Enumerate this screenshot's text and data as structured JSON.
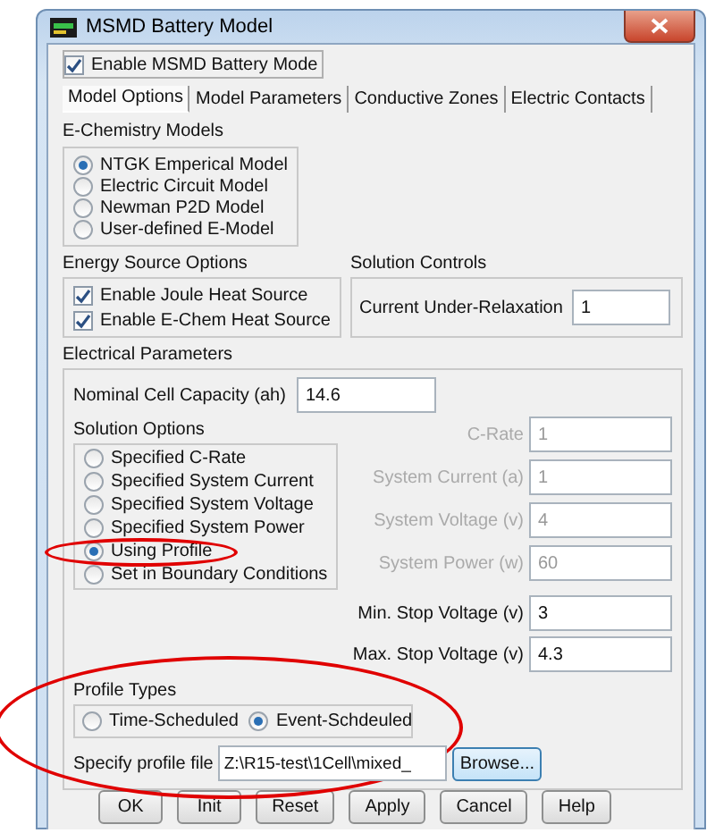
{
  "window": {
    "title": "MSMD Battery Model"
  },
  "enable_model": {
    "label": "Enable MSMD Battery Mode",
    "checked": true
  },
  "tabs": [
    {
      "label": "Model Options",
      "selected": true
    },
    {
      "label": "Model Parameters",
      "selected": false
    },
    {
      "label": "Conductive Zones",
      "selected": false
    },
    {
      "label": "Electric Contacts",
      "selected": false
    }
  ],
  "e_chemistry": {
    "title": "E-Chemistry Models",
    "options": [
      {
        "label": "NTGK Emperical Model",
        "selected": true
      },
      {
        "label": "Electric Circuit Model",
        "selected": false
      },
      {
        "label": "Newman P2D Model",
        "selected": false
      },
      {
        "label": "User-defined E-Model",
        "selected": false
      }
    ]
  },
  "energy_source": {
    "title": "Energy Source Options",
    "options": [
      {
        "label": "Enable Joule Heat Source",
        "checked": true
      },
      {
        "label": "Enable E-Chem Heat Source",
        "checked": true
      }
    ]
  },
  "solution_controls": {
    "title": "Solution Controls",
    "label": "Current Under-Relaxation",
    "value": "1"
  },
  "electrical": {
    "title": "Electrical Parameters",
    "capacity": {
      "label": "Nominal Cell Capacity  (ah)",
      "value": "14.6"
    },
    "solution_options": {
      "title": "Solution Options",
      "options": [
        {
          "label": "Specified C-Rate",
          "selected": false,
          "highlighted": false
        },
        {
          "label": "Specified System Current",
          "selected": false,
          "highlighted": false
        },
        {
          "label": "Specified System Voltage",
          "selected": false,
          "highlighted": false
        },
        {
          "label": "Specified System Power",
          "selected": false,
          "highlighted": false
        },
        {
          "label": "Using Profile",
          "selected": true,
          "highlighted": true
        },
        {
          "label": "Set in Boundary Conditions",
          "selected": false,
          "highlighted": false
        }
      ]
    },
    "parameters": [
      {
        "label": "C-Rate",
        "value": "1",
        "disabled": true
      },
      {
        "label": "System Current  (a)",
        "value": "1",
        "disabled": true
      },
      {
        "label": "System Voltage  (v)",
        "value": "4",
        "disabled": true
      },
      {
        "label": "System Power  (w)",
        "value": "60",
        "disabled": true
      }
    ],
    "stop_voltages": [
      {
        "label": "Min. Stop Voltage  (v)",
        "value": "3",
        "disabled": false
      },
      {
        "label": "Max. Stop Voltage  (v)",
        "value": "4.3",
        "disabled": false
      }
    ],
    "profile": {
      "highlighted": true,
      "title": "Profile Types",
      "options": [
        {
          "label": "Time-Scheduled",
          "selected": false
        },
        {
          "label": "Event-Schdeuled",
          "selected": true
        }
      ],
      "file_label": "Specify profile file",
      "file_value": "Z:\\R15-test\\1Cell\\mixed_",
      "browse": "Browse..."
    }
  },
  "buttons": [
    {
      "label": "OK"
    },
    {
      "label": "Init"
    },
    {
      "label": "Reset"
    },
    {
      "label": "Apply"
    },
    {
      "label": "Cancel"
    },
    {
      "label": "Help"
    }
  ]
}
